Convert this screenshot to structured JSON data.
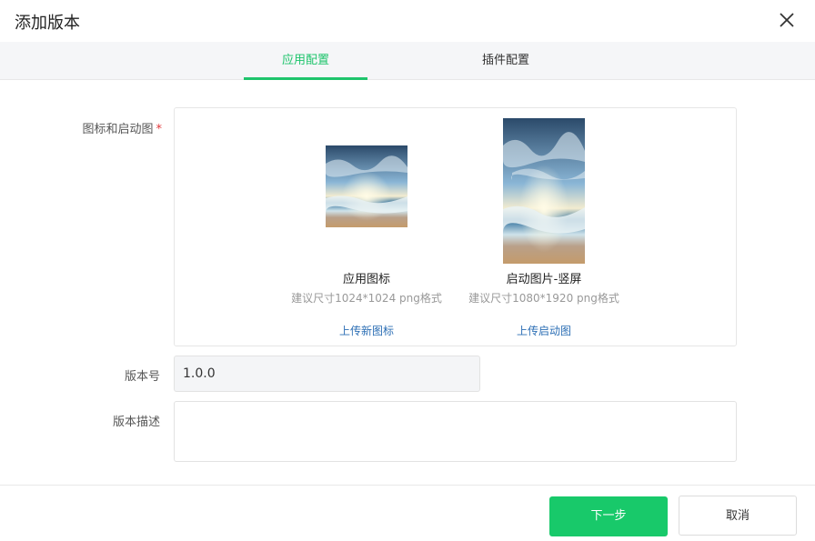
{
  "dialog": {
    "title": "添加版本"
  },
  "tabs": [
    {
      "label": "应用配置",
      "active": true
    },
    {
      "label": "插件配置",
      "active": false
    }
  ],
  "form": {
    "images_label": "图标和启动图",
    "required_mark": "*",
    "app_icon": {
      "title": "应用图标",
      "hint": "建议尺寸1024*1024 png格式",
      "upload_label": "上传新图标"
    },
    "splash": {
      "title": "启动图片-竖屏",
      "hint": "建议尺寸1080*1920 png格式",
      "upload_label": "上传启动图"
    },
    "version_label": "版本号",
    "version_value": "1.0.0",
    "description_label": "版本描述",
    "description_value": ""
  },
  "footer": {
    "next_label": "下一步",
    "cancel_label": "取消"
  },
  "colors": {
    "accent": "#1ec46c",
    "link": "#2d6fb5",
    "required": "#e2383a"
  }
}
